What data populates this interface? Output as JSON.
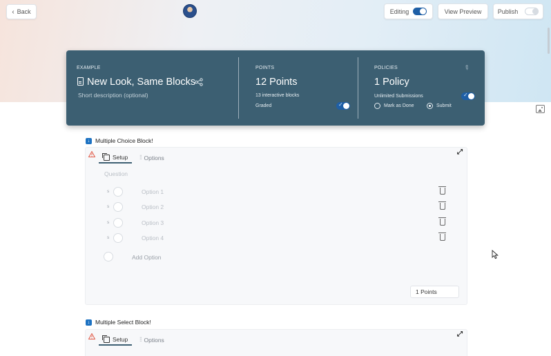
{
  "header": {
    "back_label": "Back",
    "editing_label": "Editing",
    "editing_on": true,
    "view_preview_label": "View Preview",
    "publish_label": "Publish",
    "publish_on": false
  },
  "card": {
    "example_label": "EXAMPLE",
    "title": "New Look, Same Blocks",
    "description_placeholder": "Short description (optional)",
    "points_label": "POINTS",
    "points_value": "12 Points",
    "points_sub": "13 interactive blocks",
    "graded_label": "Graded",
    "graded_on": true,
    "policies_label": "POLICIES",
    "policy_value": "1 Policy",
    "unlimited_label": "Unlimited Submissions",
    "unlimited_on": true,
    "mark_done_label": "Mark as Done",
    "submit_label": "Submit",
    "selected_completion": "Submit"
  },
  "blocks": [
    {
      "title": "Multiple Choice Block!",
      "tab_setup": "Setup",
      "tab_options": "Options",
      "question_placeholder": "Question",
      "options": [
        "Option 1",
        "Option 2",
        "Option 3",
        "Option 4"
      ],
      "option_marker": "s",
      "add_option_label": "Add Option",
      "points_value": "1 Points"
    },
    {
      "title": "Multiple Select Block!",
      "tab_setup": "Setup",
      "tab_options": "Options"
    }
  ],
  "colors": {
    "card_bg": "#3c5f72",
    "accent_blue": "#1f5fa6",
    "block_badge": "#1d72c2",
    "warning": "#e05a47"
  }
}
